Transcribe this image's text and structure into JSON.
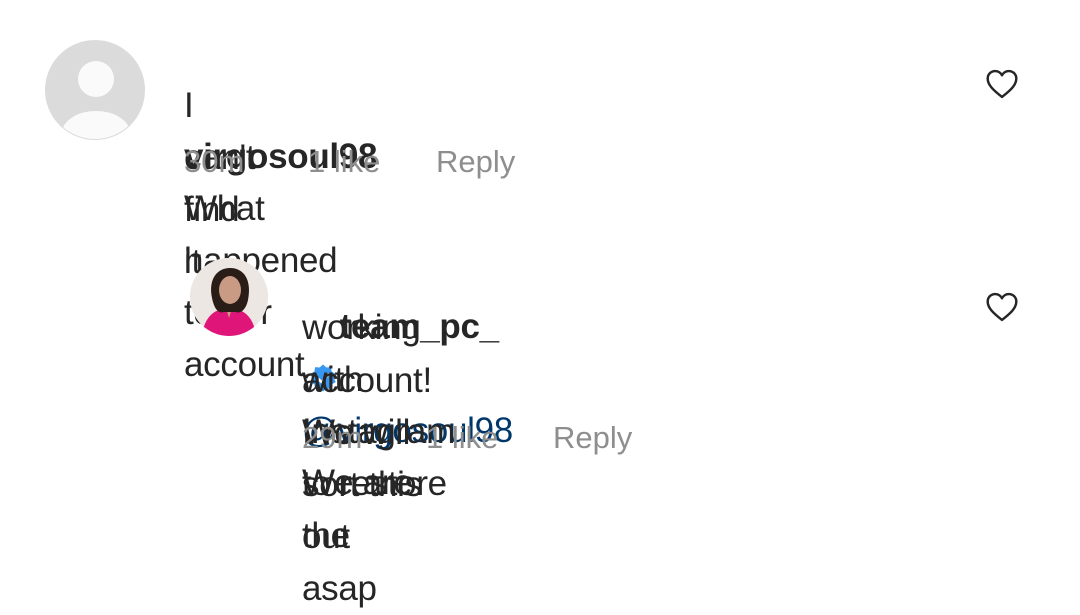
{
  "comments": [
    {
      "username": "virgosoul98",
      "text_line1": " What happened  to her account",
      "text_line2": "I can't  find it",
      "time": "30m",
      "likes": "1 like",
      "reply_label": "Reply",
      "verified": false
    },
    {
      "username": "team_pc_",
      "mention": "@virgosoul98",
      "text_line1_rest": " We are",
      "text_line2": "working with Instagram to restore the",
      "text_line3": "account! We will sort this out asap",
      "time": "29m",
      "likes": "1 like",
      "reply_label": "Reply",
      "verified": true
    }
  ],
  "colors": {
    "verified_badge": "#3897f0",
    "mention": "#00376b",
    "meta": "#8e8e8e"
  },
  "icons": [
    "default-avatar-icon",
    "verified-badge-icon",
    "heart-outline-icon"
  ]
}
